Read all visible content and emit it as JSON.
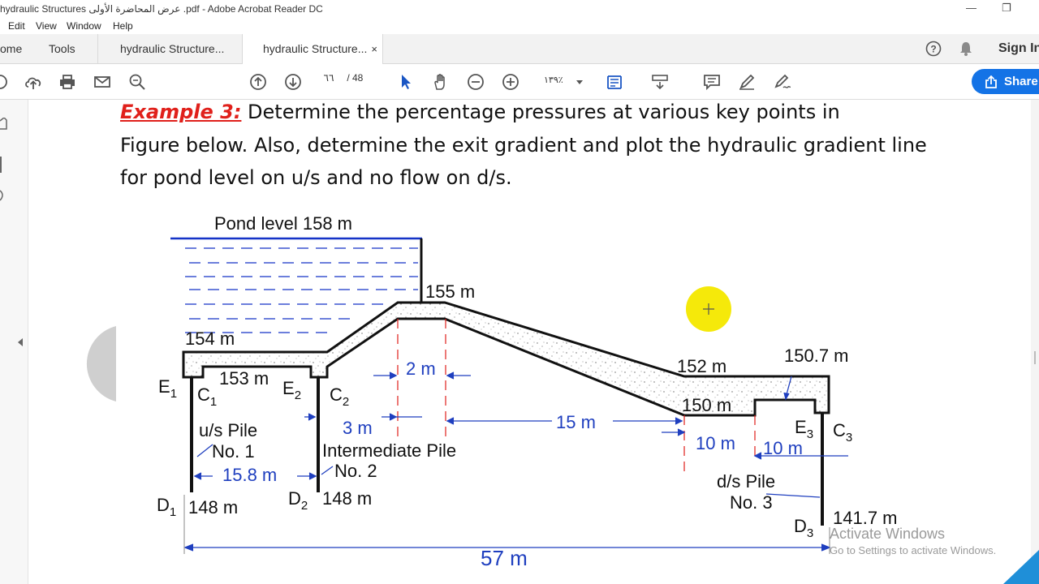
{
  "window": {
    "title": "hydraulic Structures عرض المحاضرة الأولى .pdf - Adobe Acrobat Reader DC",
    "minimize": "—",
    "restore": "❐"
  },
  "menu": [
    "Edit",
    "View",
    "Window",
    "Help"
  ],
  "tabs": {
    "home": "ome",
    "tools": "Tools",
    "doc1": "hydraulic Structure...",
    "doc2": "hydraulic Structure...",
    "close": "×"
  },
  "header_right": {
    "sign_in": "Sign In"
  },
  "toolbar": {
    "page_current": "٦٦",
    "page_total": "/ 48",
    "zoom": "١٣٩٪",
    "share": "Share"
  },
  "document": {
    "example_label": "Example 3:",
    "line1": " Determine the percentage pressures at various key points in",
    "line2": "Figure below. Also, determine the exit gradient and plot the hydraulic gradient line",
    "line3": "for pond level on u/s and no flow on d/s."
  },
  "figure": {
    "pond_level": "Pond level 158 m",
    "lvl_155": "155 m",
    "lvl_154": "154 m",
    "lvl_153": "153 m",
    "lvl_152": "152 m",
    "lvl_150_7": "150.7 m",
    "lvl_150": "150 m",
    "lvl_148a": "148 m",
    "lvl_148b": "148 m",
    "lvl_141_7": "141.7 m",
    "E1": "E",
    "E1s": "1",
    "C1": "C",
    "C1s": "1",
    "E2": "E",
    "E2s": "2",
    "C2": "C",
    "C2s": "2",
    "E3": "E",
    "E3s": "3",
    "C3": "C",
    "C3s": "3",
    "D1": "D",
    "D1s": "1",
    "D2": "D",
    "D2s": "2",
    "D3": "D",
    "D3s": "3",
    "us_pile_1": "u/s Pile",
    "us_pile_2": "No. 1",
    "int_pile_1": "Intermediate Pile",
    "int_pile_2": "No. 2",
    "ds_pile_1": "d/s Pile",
    "ds_pile_2": "No. 3",
    "dim_2": "2 m",
    "dim_3": "3 m",
    "dim_15": "15 m",
    "dim_10a": "10 m",
    "dim_10b": "10 m",
    "dim_15_8": "15.8 m",
    "dim_57": "57 m"
  },
  "watermark": {
    "line1": "Activate Windows",
    "line2": "Go to Settings to activate Windows."
  },
  "colors": {
    "accent_blue": "#1473e6",
    "dimension_blue": "#1f3fbf",
    "title_red": "#e0201b",
    "cursor_yellow": "#f5e90a"
  }
}
